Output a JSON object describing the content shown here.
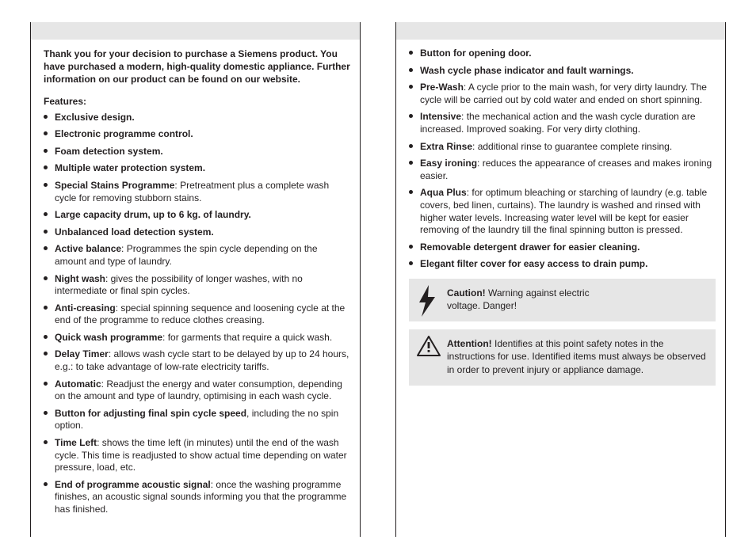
{
  "left": {
    "title": "Features:",
    "intro": "Thank you for your decision to purchase a Siemens product. You have purchased a modern, high-quality domestic appliance. Further information on our product can be found on our website.",
    "items": [
      {
        "label": "Exclusive design."
      },
      {
        "label": "Electronic programme control."
      },
      {
        "label": "Foam detection system."
      },
      {
        "label": "Multiple water protection system."
      },
      {
        "label": "Special Stains Programme",
        "desc": ": Pretreatment plus a complete wash cycle for removing stubborn stains."
      },
      {
        "label": "Large capacity drum, up to 6 kg. of laundry."
      },
      {
        "label": "Unbalanced load detection system."
      },
      {
        "label": "Active balance",
        "desc": ": Programmes the spin cycle depending on the amount and type of laundry."
      },
      {
        "label": "Night wash",
        "desc": ": gives the possibility of longer washes, with no intermediate or final spin cycles."
      },
      {
        "label": "Anti-creasing",
        "desc": ": special spinning sequence and loosening cycle at the end of the programme to reduce clothes creasing."
      },
      {
        "label": "Quick wash programme",
        "desc": ": for garments that require a quick wash."
      },
      {
        "label": "Delay Timer",
        "desc": ": allows wash cycle start to be delayed by up to 24 hours, e.g.: to take advantage of low-rate electricity tariffs."
      },
      {
        "label": "Automatic",
        "desc": ": Readjust the energy and water consumption, depending on the amount and type of laundry, optimising in each wash cycle."
      },
      {
        "label": "Button for adjusting final spin cycle speed",
        "desc": ", including the no spin option."
      },
      {
        "label": "Time Left",
        "desc": ": shows the time left (in minutes) until the end of the wash cycle. This time is readjusted to show actual time depending on water pressure, load, etc."
      },
      {
        "label": "End of programme acoustic signal",
        "desc": ": once the washing programme finishes, an acoustic signal sounds informing you that the programme has finished."
      }
    ]
  },
  "right": {
    "items": [
      {
        "label": "Button for opening door."
      },
      {
        "label": "Wash cycle phase indicator and fault warnings."
      },
      {
        "label": "Pre-Wash",
        "desc": ": A cycle prior to the main wash, for very dirty laundry. The cycle will be carried out by cold water and ended on short spinning."
      },
      {
        "label": "Intensive",
        "desc": ": the mechanical action and the wash cycle duration are increased. Improved soaking. For very dirty clothing."
      },
      {
        "label": "Extra Rinse",
        "desc": ": additional rinse to guarantee complete rinsing."
      },
      {
        "label": "Easy ironing",
        "desc": ": reduces the appearance of creases and makes ironing easier."
      },
      {
        "label": "Aqua Plus",
        "desc": ": for optimum bleaching or starching of laundry (e.g. table covers, bed linen, curtains). The laundry is washed and rinsed with higher water levels. Increasing water level will be kept for easier removing of the laundry till the final spinning button is pressed."
      },
      {
        "label": "Removable detergent drawer for easier cleaning."
      },
      {
        "label": "Elegant filter cover for easy access to drain pump."
      }
    ],
    "warning1": {
      "lead": "Caution!",
      "text": " Warning against electric voltage. Danger!"
    },
    "warning2": {
      "lead": "Attention!",
      "text": " Identifies at this point safety notes in the instructions for use. Identified items must always be observed in order to prevent injury or appliance damage."
    }
  }
}
